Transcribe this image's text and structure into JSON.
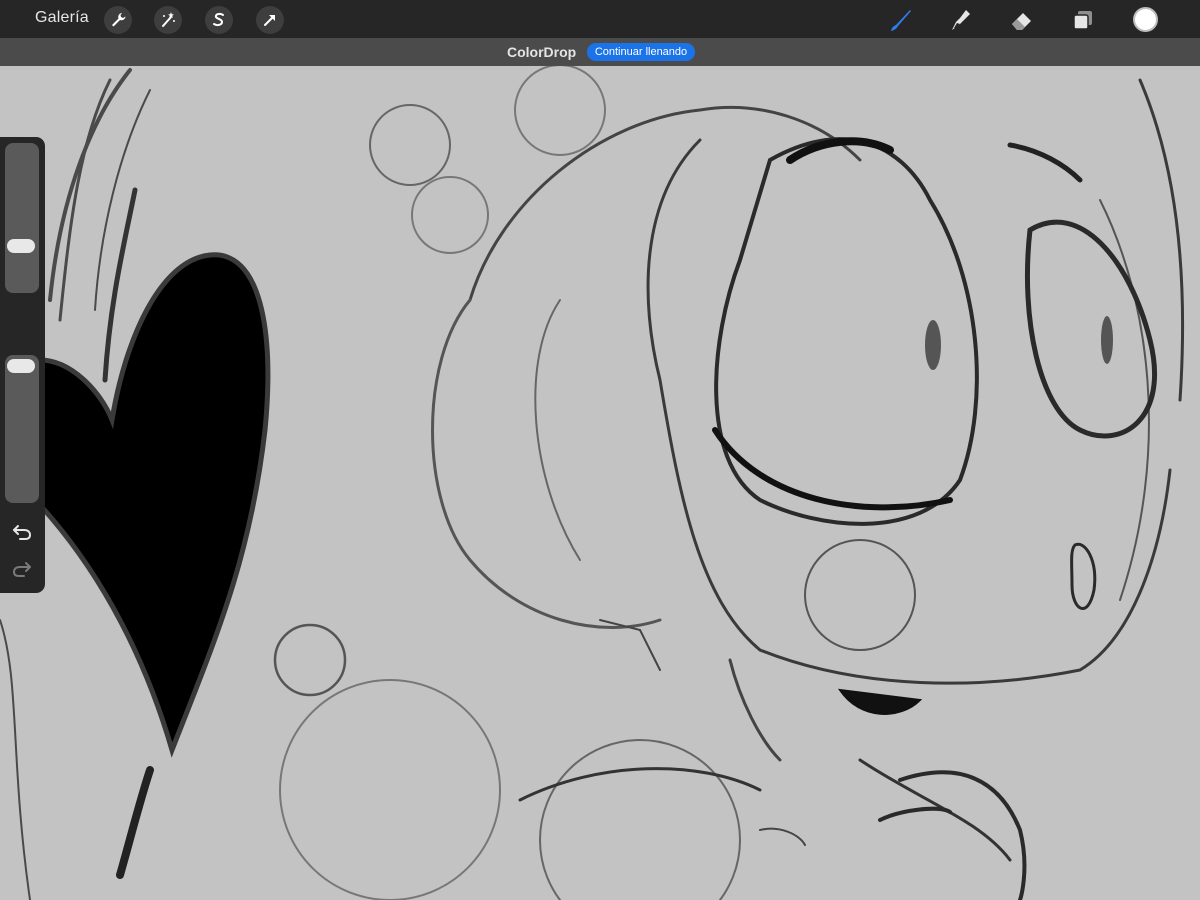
{
  "app": {
    "gallery_label": "Galería"
  },
  "toolbar": {
    "left_tools": [
      {
        "icon": "wrench-icon"
      },
      {
        "icon": "magic-wand-icon"
      },
      {
        "icon": "selection-s-icon"
      },
      {
        "icon": "transform-arrow-icon"
      }
    ],
    "right_tools": [
      {
        "icon": "brush-icon",
        "active": true
      },
      {
        "icon": "smudge-icon"
      },
      {
        "icon": "eraser-icon"
      },
      {
        "icon": "layers-icon"
      }
    ],
    "current_color": "#ffffff",
    "accent": "#2f7cf6"
  },
  "subbar": {
    "title": "ColorDrop",
    "action_label": "Continuar llenando"
  },
  "canvas": {
    "background": "#c3c3c3",
    "content": "sketch-artwork"
  },
  "sidebar": {
    "brush_size_level": 0.62,
    "opacity_level": 1.0
  }
}
